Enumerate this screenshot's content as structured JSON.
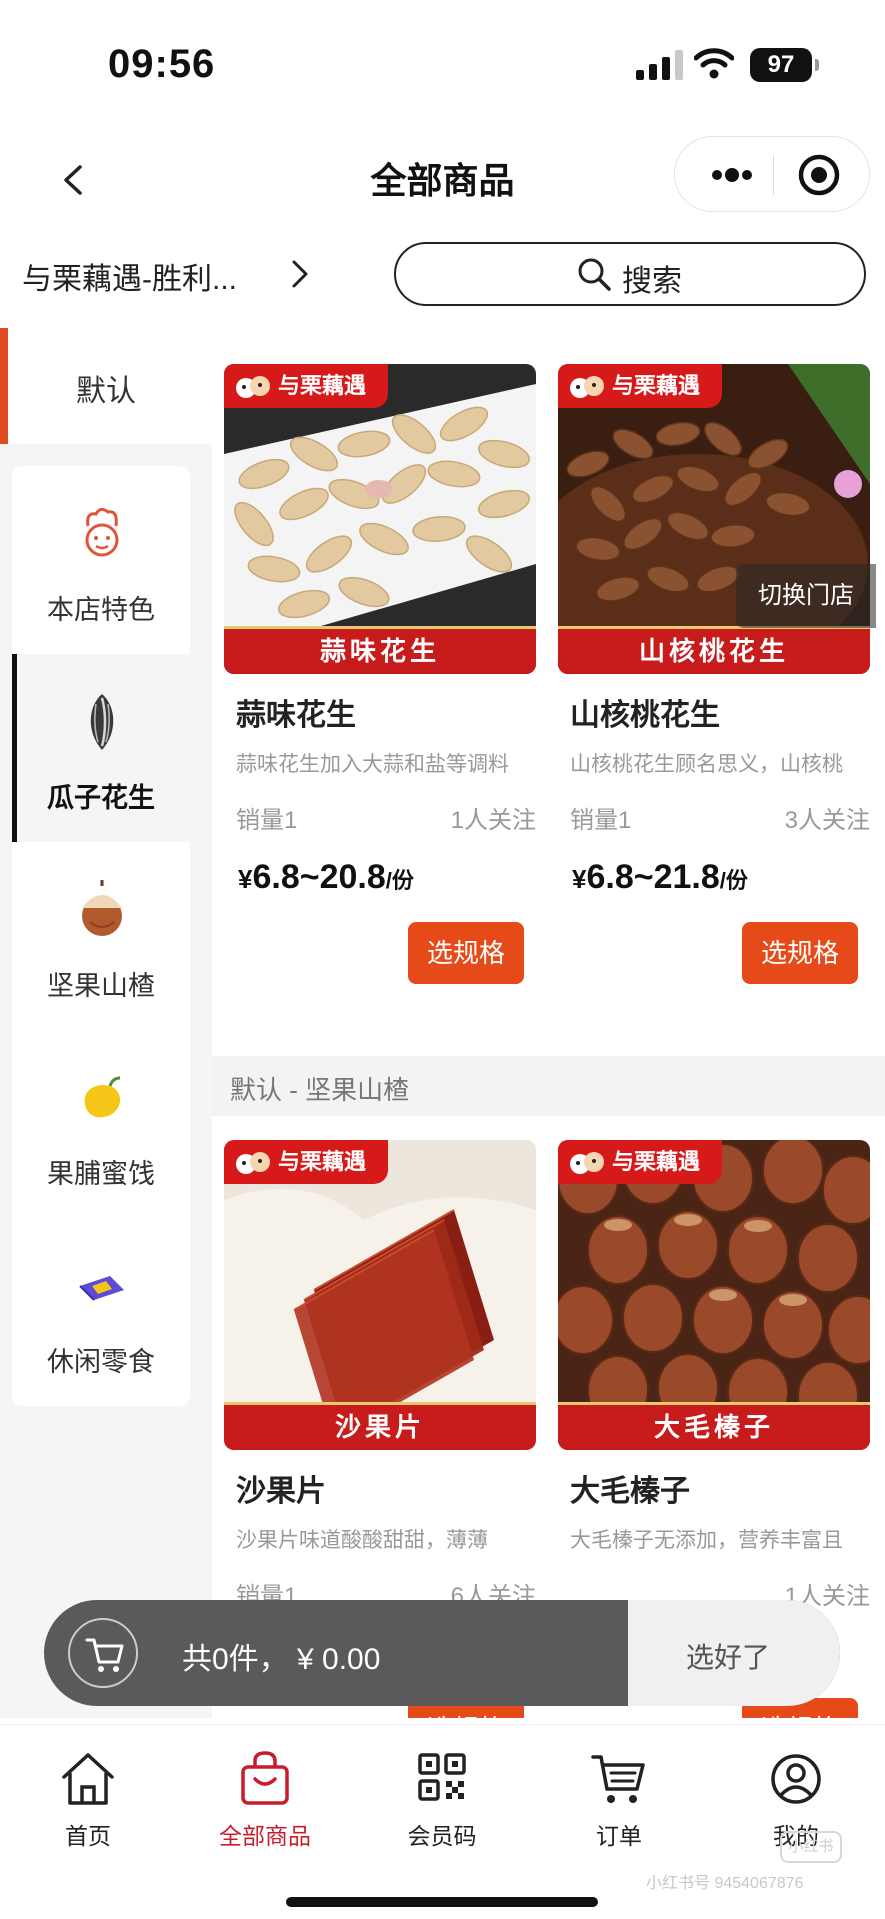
{
  "status_bar": {
    "time": "09:56",
    "battery": "97"
  },
  "nav": {
    "title": "全部商品"
  },
  "store": {
    "name": "与栗藕遇-胜利...",
    "search_label": "搜索"
  },
  "sidebar": {
    "default_tab": "默认",
    "categories": [
      {
        "label": "本店特色",
        "icon": "chef-icon"
      },
      {
        "label": "瓜子花生",
        "icon": "sunflower-seed-icon"
      },
      {
        "label": "坚果山楂",
        "icon": "hazelnut-icon"
      },
      {
        "label": "果脯蜜饯",
        "icon": "mango-icon"
      },
      {
        "label": "休闲零食",
        "icon": "snack-bag-icon"
      }
    ],
    "active_index": 1
  },
  "brand": "与栗藕遇",
  "products": [
    {
      "banner": "蒜味花生",
      "title": "蒜味花生",
      "desc": "蒜味花生加入大蒜和盐等调料",
      "sales": "销量1",
      "follow": "1人关注",
      "price_yen": "¥",
      "price": "6.8~20.8",
      "unit": "/份",
      "button": "选规格"
    },
    {
      "banner": "山核桃花生",
      "title": "山核桃花生",
      "desc": "山核桃花生顾名思义，山核桃",
      "sales": "销量1",
      "follow": "3人关注",
      "price_yen": "¥",
      "price": "6.8~21.8",
      "unit": "/份",
      "button": "选规格"
    },
    {
      "banner": "沙果片",
      "title": "沙果片",
      "desc": "沙果片味道酸酸甜甜，薄薄",
      "sales": "销量1",
      "follow": "6人关注",
      "button": "选规格"
    },
    {
      "banner": "大毛榛子",
      "title": "大毛榛子",
      "desc": "大毛榛子无添加，营养丰富且",
      "sales": "",
      "follow": "1人关注",
      "button": "选规格"
    }
  ],
  "section_header": "默认 - 坚果山楂",
  "switch_store": "切换门店",
  "cart": {
    "total": "共0件，  ¥ 0.00",
    "checkout": "选好了"
  },
  "tabs": [
    {
      "label": "首页",
      "icon": "home-icon"
    },
    {
      "label": "全部商品",
      "icon": "shopping-bag-icon"
    },
    {
      "label": "会员码",
      "icon": "qr-code-icon"
    },
    {
      "label": "订单",
      "icon": "cart-icon"
    },
    {
      "label": "我的",
      "icon": "user-icon"
    }
  ],
  "tabs_active_index": 1,
  "watermark": {
    "text": "小红书号 9454067876",
    "logo": "小红书"
  },
  "colors": {
    "accent": "#e64a19",
    "brand_red": "#c81c1c",
    "tab_active": "#c81c2c"
  }
}
